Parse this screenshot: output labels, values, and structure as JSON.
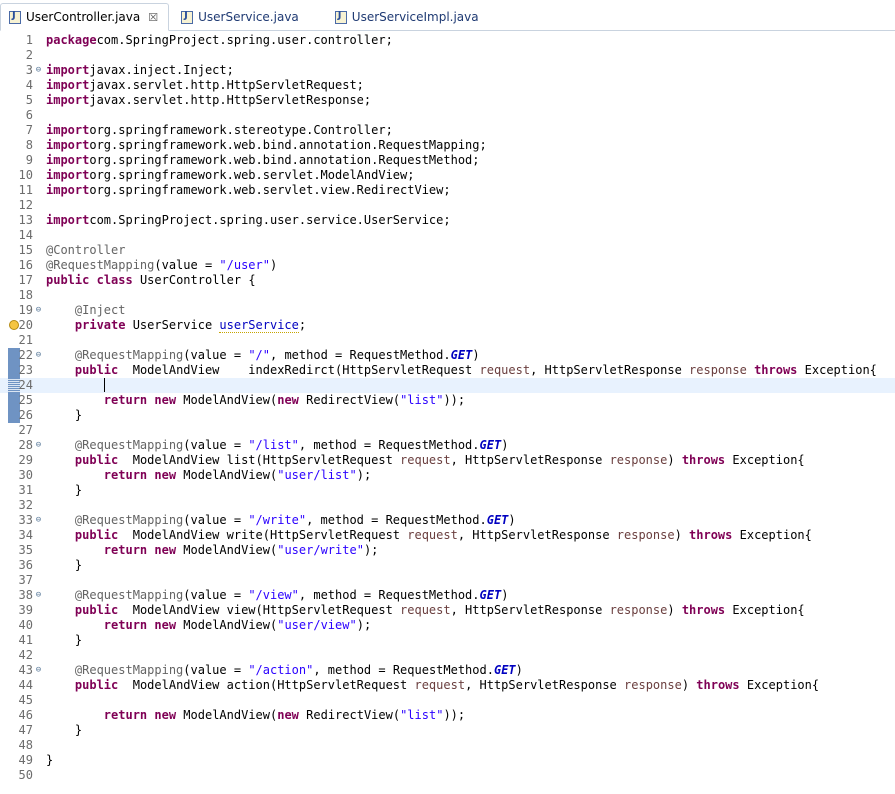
{
  "tabs": [
    {
      "label": "UserController.java",
      "active": true,
      "close": "☒"
    },
    {
      "label": "UserService.java",
      "active": false
    },
    {
      "label": "UserServiceImpl.java",
      "active": false
    }
  ],
  "colors": {
    "keyword": "#7f0055",
    "annotation": "#646464",
    "string": "#2a00ff",
    "constant": "#0000c0",
    "parameter": "#6a3e3e",
    "line_number": "#6d6d6d",
    "current_line": "#e8f2fe",
    "gutter_change": "#6f93c3"
  },
  "editor": {
    "lines": [
      {
        "n": "1",
        "tokens": [
          [
            "kw",
            "package"
          ],
          [
            "",
            "com.SpringProject.spring.user.controller;"
          ]
        ]
      },
      {
        "n": "2",
        "tokens": []
      },
      {
        "n": "3",
        "fold": "⊖",
        "tokens": [
          [
            "kw",
            "import"
          ],
          [
            "",
            "javax.inject.Inject;"
          ]
        ]
      },
      {
        "n": "4",
        "tokens": [
          [
            "kw",
            "import"
          ],
          [
            "",
            "javax.servlet.http.HttpServletRequest;"
          ]
        ]
      },
      {
        "n": "5",
        "tokens": [
          [
            "kw",
            "import"
          ],
          [
            "",
            "javax.servlet.http.HttpServletResponse;"
          ]
        ]
      },
      {
        "n": "6",
        "tokens": []
      },
      {
        "n": "7",
        "tokens": [
          [
            "kw",
            "import"
          ],
          [
            "",
            "org.springframework.stereotype.Controller;"
          ]
        ]
      },
      {
        "n": "8",
        "tokens": [
          [
            "kw",
            "import"
          ],
          [
            "",
            "org.springframework.web.bind.annotation.RequestMapping;"
          ]
        ]
      },
      {
        "n": "9",
        "tokens": [
          [
            "kw",
            "import"
          ],
          [
            "",
            "org.springframework.web.bind.annotation.RequestMethod;"
          ]
        ]
      },
      {
        "n": "10",
        "tokens": [
          [
            "kw",
            "import"
          ],
          [
            "",
            "org.springframework.web.servlet.ModelAndView;"
          ]
        ]
      },
      {
        "n": "11",
        "tokens": [
          [
            "kw",
            "import"
          ],
          [
            "",
            "org.springframework.web.servlet.view.RedirectView;"
          ]
        ]
      },
      {
        "n": "12",
        "tokens": []
      },
      {
        "n": "13",
        "tokens": [
          [
            "kw",
            "import"
          ],
          [
            "",
            "com.SpringProject.spring.user.service.UserService;"
          ]
        ]
      },
      {
        "n": "14",
        "tokens": []
      },
      {
        "n": "15",
        "tokens": [
          [
            "ann",
            "@Controller"
          ]
        ]
      },
      {
        "n": "16",
        "tokens": [
          [
            "ann",
            "@RequestMapping"
          ],
          [
            "",
            "(value = "
          ],
          [
            "str",
            "\"/user\""
          ],
          [
            "",
            ")"
          ]
        ]
      },
      {
        "n": "17",
        "tokens": [
          [
            "kw",
            "public"
          ],
          [
            "",
            " "
          ],
          [
            "kw",
            "class"
          ],
          [
            "",
            " UserController {"
          ]
        ]
      },
      {
        "n": "18",
        "tokens": []
      },
      {
        "n": "19",
        "fold": "⊖",
        "tokens": [
          [
            "",
            "    "
          ],
          [
            "ann",
            "@Inject"
          ]
        ]
      },
      {
        "n": "20",
        "warn": true,
        "tokens": [
          [
            "",
            "    "
          ],
          [
            "kw",
            "private"
          ],
          [
            "",
            " UserService "
          ],
          [
            "field",
            "userService"
          ],
          [
            "",
            ";"
          ]
        ]
      },
      {
        "n": "21",
        "tokens": []
      },
      {
        "n": "22",
        "fold": "⊖",
        "mark": "solid",
        "tokens": [
          [
            "",
            "    "
          ],
          [
            "ann",
            "@RequestMapping"
          ],
          [
            "",
            "(value = "
          ],
          [
            "str",
            "\"/\""
          ],
          [
            "",
            ", method = RequestMethod."
          ],
          [
            "con",
            "GET"
          ],
          [
            "",
            ")"
          ]
        ]
      },
      {
        "n": "23",
        "mark": "solid",
        "tokens": [
          [
            "",
            "    "
          ],
          [
            "kw",
            "public"
          ],
          [
            "",
            "  ModelAndView    indexRedirct(HttpServletRequest "
          ],
          [
            "param",
            "request"
          ],
          [
            "",
            ", HttpServletResponse "
          ],
          [
            "param",
            "response"
          ],
          [
            "",
            " "
          ],
          [
            "kw",
            "throws"
          ],
          [
            "",
            " Exception{"
          ]
        ]
      },
      {
        "n": "24",
        "mark": "hatched",
        "cursor": true,
        "tokens": [
          [
            "",
            "        "
          ]
        ]
      },
      {
        "n": "25",
        "mark": "solid",
        "tokens": [
          [
            "",
            "        "
          ],
          [
            "kw",
            "return"
          ],
          [
            "",
            " "
          ],
          [
            "kw",
            "new"
          ],
          [
            "",
            " ModelAndView("
          ],
          [
            "kw",
            "new"
          ],
          [
            "",
            " RedirectView("
          ],
          [
            "str",
            "\"list\""
          ],
          [
            "",
            "));"
          ]
        ]
      },
      {
        "n": "26",
        "mark": "solid",
        "tokens": [
          [
            "",
            "    }"
          ]
        ]
      },
      {
        "n": "27",
        "tokens": []
      },
      {
        "n": "28",
        "fold": "⊖",
        "tokens": [
          [
            "",
            "    "
          ],
          [
            "ann",
            "@RequestMapping"
          ],
          [
            "",
            "(value = "
          ],
          [
            "str",
            "\"/list\""
          ],
          [
            "",
            ", method = RequestMethod."
          ],
          [
            "con",
            "GET"
          ],
          [
            "",
            ")"
          ]
        ]
      },
      {
        "n": "29",
        "tokens": [
          [
            "",
            "    "
          ],
          [
            "kw",
            "public"
          ],
          [
            "",
            "  ModelAndView list(HttpServletRequest "
          ],
          [
            "param",
            "request"
          ],
          [
            "",
            ", HttpServletResponse "
          ],
          [
            "param",
            "response"
          ],
          [
            "",
            ") "
          ],
          [
            "kw",
            "throws"
          ],
          [
            "",
            " Exception{"
          ]
        ]
      },
      {
        "n": "30",
        "tokens": [
          [
            "",
            "        "
          ],
          [
            "kw",
            "return"
          ],
          [
            "",
            " "
          ],
          [
            "kw",
            "new"
          ],
          [
            "",
            " ModelAndView("
          ],
          [
            "str",
            "\"user/list\""
          ],
          [
            "",
            ");"
          ]
        ]
      },
      {
        "n": "31",
        "tokens": [
          [
            "",
            "    }"
          ]
        ]
      },
      {
        "n": "32",
        "tokens": []
      },
      {
        "n": "33",
        "fold": "⊖",
        "tokens": [
          [
            "",
            "    "
          ],
          [
            "ann",
            "@RequestMapping"
          ],
          [
            "",
            "(value = "
          ],
          [
            "str",
            "\"/write\""
          ],
          [
            "",
            ", method = RequestMethod."
          ],
          [
            "con",
            "GET"
          ],
          [
            "",
            ")"
          ]
        ]
      },
      {
        "n": "34",
        "tokens": [
          [
            "",
            "    "
          ],
          [
            "kw",
            "public"
          ],
          [
            "",
            "  ModelAndView write(HttpServletRequest "
          ],
          [
            "param",
            "request"
          ],
          [
            "",
            ", HttpServletResponse "
          ],
          [
            "param",
            "response"
          ],
          [
            "",
            ") "
          ],
          [
            "kw",
            "throws"
          ],
          [
            "",
            " Exception{"
          ]
        ]
      },
      {
        "n": "35",
        "tokens": [
          [
            "",
            "        "
          ],
          [
            "kw",
            "return"
          ],
          [
            "",
            " "
          ],
          [
            "kw",
            "new"
          ],
          [
            "",
            " ModelAndView("
          ],
          [
            "str",
            "\"user/write\""
          ],
          [
            "",
            ");"
          ]
        ]
      },
      {
        "n": "36",
        "tokens": [
          [
            "",
            "    }"
          ]
        ]
      },
      {
        "n": "37",
        "tokens": []
      },
      {
        "n": "38",
        "fold": "⊖",
        "tokens": [
          [
            "",
            "    "
          ],
          [
            "ann",
            "@RequestMapping"
          ],
          [
            "",
            "(value = "
          ],
          [
            "str",
            "\"/view\""
          ],
          [
            "",
            ", method = RequestMethod."
          ],
          [
            "con",
            "GET"
          ],
          [
            "",
            ")"
          ]
        ]
      },
      {
        "n": "39",
        "tokens": [
          [
            "",
            "    "
          ],
          [
            "kw",
            "public"
          ],
          [
            "",
            "  ModelAndView view(HttpServletRequest "
          ],
          [
            "param",
            "request"
          ],
          [
            "",
            ", HttpServletResponse "
          ],
          [
            "param",
            "response"
          ],
          [
            "",
            ") "
          ],
          [
            "kw",
            "throws"
          ],
          [
            "",
            " Exception{"
          ]
        ]
      },
      {
        "n": "40",
        "tokens": [
          [
            "",
            "        "
          ],
          [
            "kw",
            "return"
          ],
          [
            "",
            " "
          ],
          [
            "kw",
            "new"
          ],
          [
            "",
            " ModelAndView("
          ],
          [
            "str",
            "\"user/view\""
          ],
          [
            "",
            ");"
          ]
        ]
      },
      {
        "n": "41",
        "tokens": [
          [
            "",
            "    }"
          ]
        ]
      },
      {
        "n": "42",
        "tokens": []
      },
      {
        "n": "43",
        "fold": "⊖",
        "tokens": [
          [
            "",
            "    "
          ],
          [
            "ann",
            "@RequestMapping"
          ],
          [
            "",
            "(value = "
          ],
          [
            "str",
            "\"/action\""
          ],
          [
            "",
            ", method = RequestMethod."
          ],
          [
            "con",
            "GET"
          ],
          [
            "",
            ")"
          ]
        ]
      },
      {
        "n": "44",
        "tokens": [
          [
            "",
            "    "
          ],
          [
            "kw",
            "public"
          ],
          [
            "",
            "  ModelAndView action(HttpServletRequest "
          ],
          [
            "param",
            "request"
          ],
          [
            "",
            ", HttpServletResponse "
          ],
          [
            "param",
            "response"
          ],
          [
            "",
            ") "
          ],
          [
            "kw",
            "throws"
          ],
          [
            "",
            " Exception{"
          ]
        ]
      },
      {
        "n": "45",
        "tokens": []
      },
      {
        "n": "46",
        "tokens": [
          [
            "",
            "        "
          ],
          [
            "kw",
            "return"
          ],
          [
            "",
            " "
          ],
          [
            "kw",
            "new"
          ],
          [
            "",
            " ModelAndView("
          ],
          [
            "kw",
            "new"
          ],
          [
            "",
            " RedirectView("
          ],
          [
            "str",
            "\"list\""
          ],
          [
            "",
            "));"
          ]
        ]
      },
      {
        "n": "47",
        "tokens": [
          [
            "",
            "    }"
          ]
        ]
      },
      {
        "n": "48",
        "tokens": []
      },
      {
        "n": "49",
        "tokens": [
          [
            "",
            "}"
          ]
        ]
      },
      {
        "n": "50",
        "tokens": []
      }
    ]
  }
}
